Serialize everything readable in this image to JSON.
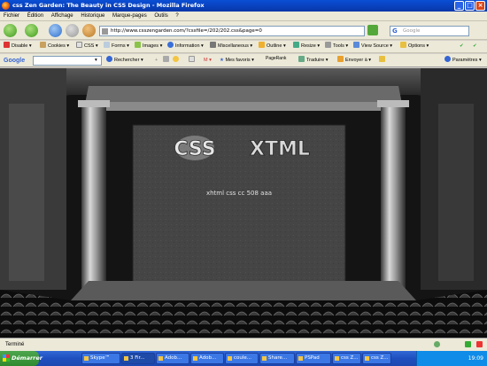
{
  "window": {
    "title": "css Zen Garden: The Beauty in CSS Design - Mozilla Firefox",
    "controls": [
      "minimize",
      "maximize",
      "close"
    ]
  },
  "menu": [
    "Fichier",
    "Édition",
    "Affichage",
    "Historique",
    "Marque-pages",
    "Outils",
    "?"
  ],
  "navigation": {
    "url": "http://www.csszengarden.com/?cssfile=/202/202.css&page=0",
    "search_engine": "G",
    "search_placeholder": "Google"
  },
  "web_developer_toolbar": [
    "Disable",
    "Cookies",
    "CSS",
    "Forms",
    "Images",
    "Information",
    "Miscellaneous",
    "Outline",
    "Resize",
    "Tools",
    "View Source",
    "Options"
  ],
  "google_toolbar": {
    "logo": "Google",
    "search_button": "Rechercher",
    "favorites": "Mes favoris",
    "pagerank": "PageRank",
    "translate": "Traduire",
    "send": "Envoyer à",
    "settings": "Paramètres"
  },
  "page": {
    "logo_left": "CSS",
    "logo_right": "XTML",
    "tagline": "xhtml  css  cc  508  aaa"
  },
  "status": {
    "text": "Terminé"
  },
  "taskbar": {
    "start": "Démarrer",
    "tasks": [
      "Skype™",
      "3 Fir...",
      "Adob...",
      "Adob...",
      "coule...",
      "Share...",
      "PSPad",
      "css Z...",
      "css Z..."
    ],
    "clock": "19:09"
  },
  "colors": {
    "title_bar": "#0a4fd6",
    "chrome": "#ece9d8",
    "taskbar": "#245edb",
    "start": "#3c9a3c",
    "stage_bg": "#111111",
    "screen": "#4a4a4a"
  }
}
